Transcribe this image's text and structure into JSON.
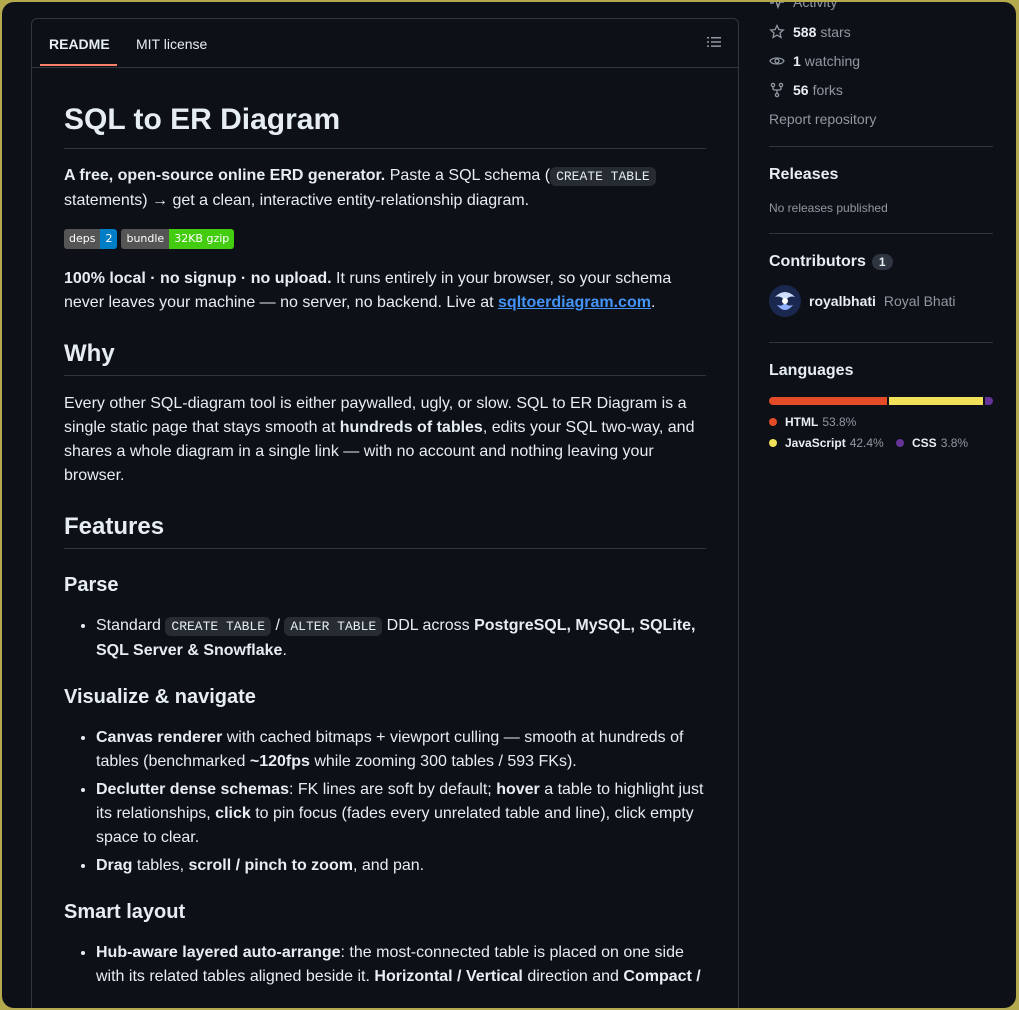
{
  "readme": {
    "tabs": [
      "README",
      "MIT license"
    ],
    "title": "SQL to ER Diagram",
    "intro_bold": "A free, open-source online ERD generator.",
    "intro_text1": " Paste a SQL schema (",
    "intro_code": "CREATE TABLE",
    "intro_text2": " statements) → get a clean, interactive entity-relationship diagram.",
    "badges": [
      {
        "key": "deps",
        "value": "2",
        "color": "#007ec6"
      },
      {
        "key": "bundle",
        "value": "32KB gzip",
        "color": "#44cc11"
      }
    ],
    "local_bold": "100% local · no signup · no upload.",
    "local_text": " It runs entirely in your browser, so your schema never leaves your machine — no server, no backend. Live at ",
    "local_link": "sqltoerdiagram.com",
    "local_end": ".",
    "why_heading": "Why",
    "why_text1": "Every other SQL-diagram tool is either paywalled, ugly, or slow. SQL to ER Diagram is a single static page that stays smooth at ",
    "why_bold": "hundreds of tables",
    "why_text2": ", edits your SQL two-way, and shares a whole diagram in a single link — with no account and nothing leaving your browser.",
    "features_heading": "Features",
    "parse_heading": "Parse",
    "parse_item": {
      "t1": "Standard ",
      "c1": "CREATE TABLE",
      "t2": " / ",
      "c2": "ALTER TABLE",
      "t3": " DDL across ",
      "b1": "PostgreSQL, MySQL, SQLite, SQL Server & Snowflake",
      "t4": "."
    },
    "visualize_heading": "Visualize & navigate",
    "vis_items": {
      "i1_b": "Canvas renderer",
      "i1_t1": " with cached bitmaps + viewport culling — smooth at hundreds of tables (benchmarked ",
      "i1_b2": "~120fps",
      "i1_t2": " while zooming 300 tables / 593 FKs).",
      "i2_b": "Declutter dense schemas",
      "i2_t1": ": FK lines are soft by default; ",
      "i2_b2": "hover",
      "i2_t2": " a table to highlight just its relationships, ",
      "i2_b3": "click",
      "i2_t3": " to pin focus (fades every unrelated table and line), click empty space to clear.",
      "i3_b": "Drag",
      "i3_t1": " tables, ",
      "i3_b2": "scroll / pinch to zoom",
      "i3_t2": ", and pan."
    },
    "layout_heading": "Smart layout",
    "layout_item": {
      "b1": "Hub-aware layered auto-arrange",
      "t1": ": the most-connected table is placed on one side with its related tables aligned beside it. ",
      "b2": "Horizontal / Vertical",
      "t2": " direction and ",
      "b3": "Compact /"
    }
  },
  "sidebar": {
    "activity": "Activity",
    "stars_count": "588",
    "stars_label": "stars",
    "watching_count": "1",
    "watching_label": "watching",
    "forks_count": "56",
    "forks_label": "forks",
    "report": "Report repository",
    "releases_heading": "Releases",
    "releases_text": "No releases published",
    "contributors_heading": "Contributors",
    "contributors_count": "1",
    "contributor_login": "royalbhati",
    "contributor_name": "Royal Bhati",
    "languages_heading": "Languages",
    "languages": [
      {
        "name": "HTML",
        "percent": "53.8%",
        "value": 53.8,
        "color": "#e34c26"
      },
      {
        "name": "JavaScript",
        "percent": "42.4%",
        "value": 42.4,
        "color": "#f1e05a"
      },
      {
        "name": "CSS",
        "percent": "3.8%",
        "value": 3.8,
        "color": "#663399"
      }
    ]
  }
}
